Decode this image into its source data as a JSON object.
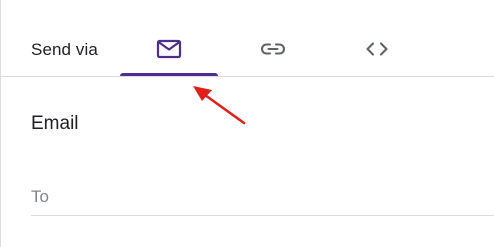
{
  "share": {
    "send_via_label": "Send via",
    "tabs": [
      {
        "id": "email",
        "icon": "envelope-icon",
        "selected": true
      },
      {
        "id": "link",
        "icon": "link-icon",
        "selected": false
      },
      {
        "id": "embed",
        "icon": "code-brackets-icon",
        "selected": false
      }
    ],
    "section_title": "Email",
    "to_field": {
      "placeholder": "To",
      "value": ""
    }
  },
  "colors": {
    "accent": "#4d2e8c",
    "divider": "#dadce0",
    "text": "#202124",
    "icon": "#5f6368",
    "placeholder": "#80868b",
    "annotation_arrow": "#e0201b"
  }
}
